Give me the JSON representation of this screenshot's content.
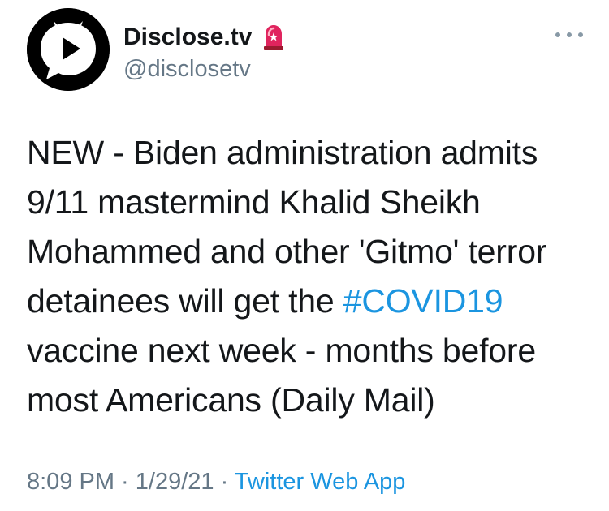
{
  "tweet": {
    "author": {
      "display_name": "Disclose.tv",
      "handle": "@disclosetv",
      "badge_icon": "siren-icon",
      "avatar_icon": "play-chat-logo-icon"
    },
    "more_icon": "more-options-icon",
    "text_lines": [
      {
        "text": "NEW - Biden administration admits"
      },
      {
        "text": "9/11 mastermind Khalid Sheikh"
      },
      {
        "text": "Mohammed and other 'Gitmo' terror"
      },
      {
        "before": "detainees will get the ",
        "hashtag": "#COVID19"
      },
      {
        "text": "vaccine next week - months before"
      },
      {
        "text": "most Americans (Daily Mail)"
      }
    ],
    "time": "8:09 PM",
    "separator1": " · ",
    "date": "1/29/21",
    "separator2": " · ",
    "source": "Twitter Web App"
  },
  "colors": {
    "text": "#14171a",
    "secondary": "#657786",
    "link": "#1b95e0",
    "siren_red": "#e0245e"
  }
}
